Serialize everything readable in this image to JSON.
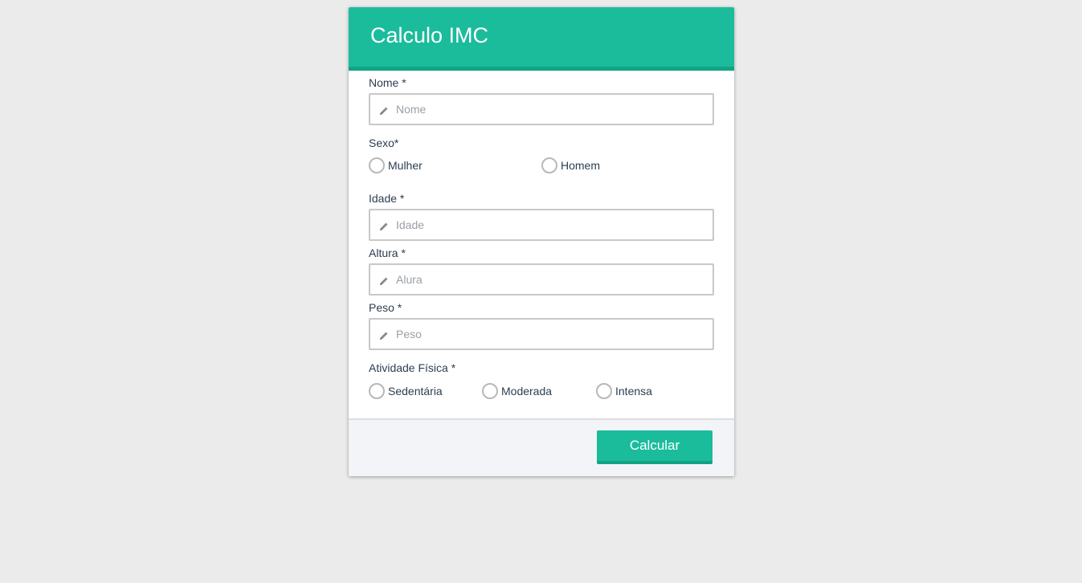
{
  "form": {
    "title": "Calculo IMC",
    "nome": {
      "label": "Nome *",
      "placeholder": "Nome",
      "value": ""
    },
    "sexo": {
      "label": "Sexo*",
      "options": [
        "Mulher",
        "Homem"
      ]
    },
    "idade": {
      "label": "Idade *",
      "placeholder": "Idade",
      "value": ""
    },
    "altura": {
      "label": "Altura *",
      "placeholder": "Alura",
      "value": ""
    },
    "peso": {
      "label": "Peso *",
      "placeholder": "Peso",
      "value": ""
    },
    "atividade": {
      "label": "Atividade Física *",
      "options": [
        "Sedentária",
        "Moderada",
        "Intensa"
      ]
    },
    "submit_label": "Calcular"
  },
  "colors": {
    "accent": "#1abc9c",
    "accent_dark": "#11a383",
    "background": "#ebebeb",
    "footer_bg": "#f3f4f8",
    "text": "#2c3e50"
  },
  "icons": {
    "field_icon": "pencil-icon",
    "radio_icon": "radio-circle-icon"
  }
}
